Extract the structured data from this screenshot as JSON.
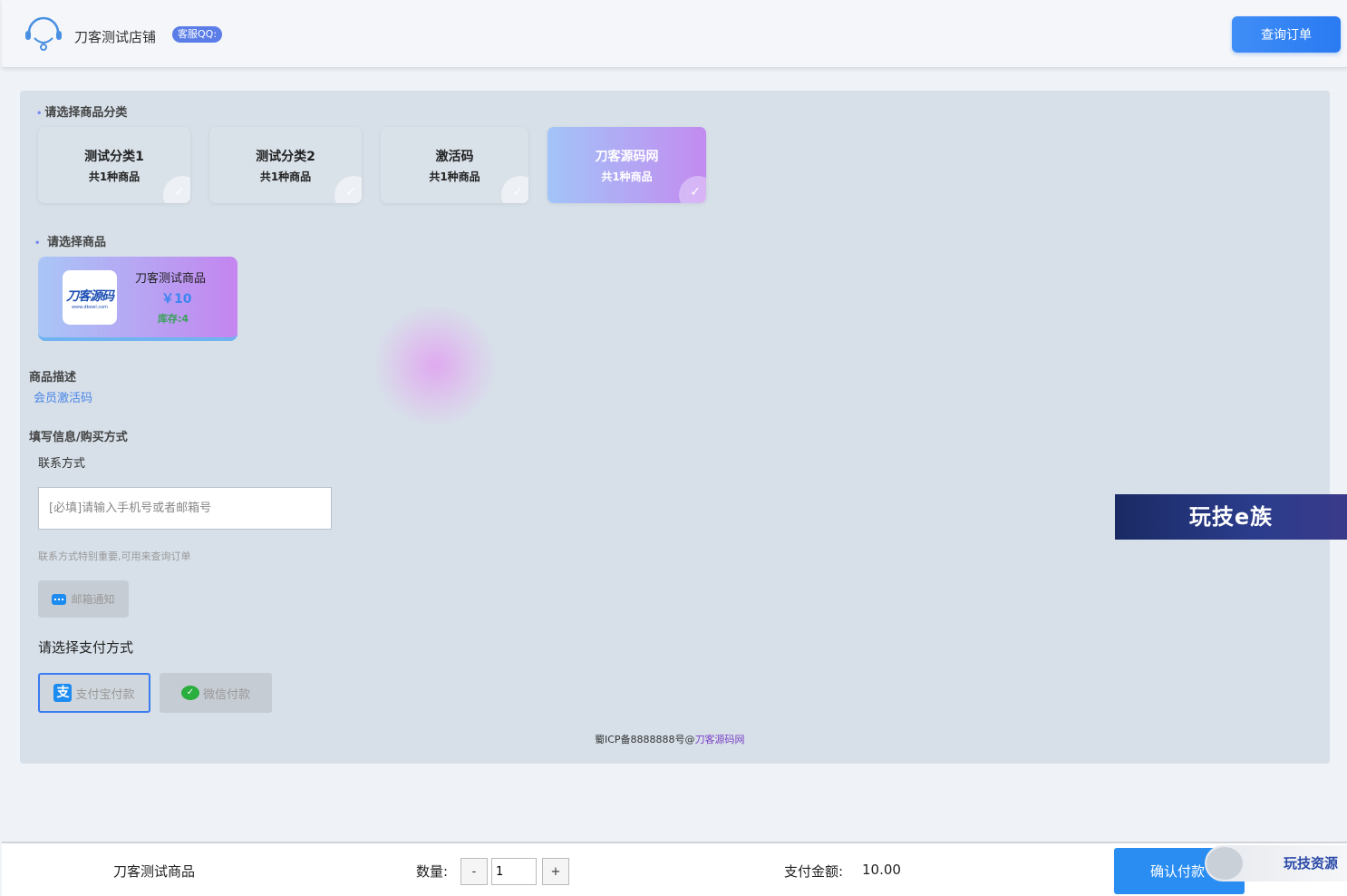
{
  "header": {
    "shop_name": "刀客测试店铺",
    "qq_badge": "客服QQ:",
    "query_button": "查询订单"
  },
  "categories": {
    "label": "请选择商品分类",
    "items": [
      {
        "name": "测试分类1",
        "count": "共1种商品",
        "selected": false
      },
      {
        "name": "测试分类2",
        "count": "共1种商品",
        "selected": false
      },
      {
        "name": "激活码",
        "count": "共1种商品",
        "selected": false
      },
      {
        "name": "刀客源码网",
        "count": "共1种商品",
        "selected": true
      }
    ]
  },
  "goods": {
    "label": "请选择商品",
    "item": {
      "logo_text": "刀客源码",
      "logo_sub": "www.dkewl.com",
      "name": "刀客测试商品",
      "price": "￥10",
      "stock": "库存:4"
    }
  },
  "description": {
    "label": "商品描述",
    "text": "会员激活码"
  },
  "form": {
    "section_label": "填写信息/购买方式",
    "contact_label": "联系方式",
    "contact_placeholder": "[必填]请输入手机号或者邮箱号",
    "contact_hint": "联系方式特别重要,可用来查询订单",
    "email_notify": "邮箱通知",
    "pay_label": "请选择支付方式",
    "pay_alipay": "支付宝付款",
    "pay_wechat": "微信付款"
  },
  "icp": {
    "text": "蜀ICP备8888888号@",
    "link": "刀客源码网"
  },
  "watermark": {
    "main": "玩技e族",
    "small": "玩技资源"
  },
  "footer": {
    "goods_name": "刀客测试商品",
    "qty_label": "数量:",
    "qty_minus": "-",
    "qty_value": "1",
    "qty_plus": "+",
    "amount_label": "支付金额:",
    "amount_value": "10.00",
    "confirm": "确认付款"
  }
}
